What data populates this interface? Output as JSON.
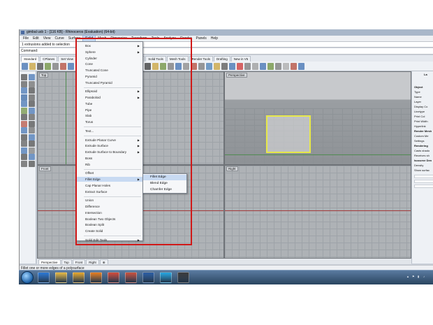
{
  "window": {
    "title": "gimbal usb 1 - [116 KB] - Rhinoceros (Evaluation) (64-bit)"
  },
  "menubar": {
    "items": [
      "File",
      "Edit",
      "View",
      "Curve",
      "Surface",
      "Solid",
      "Mesh",
      "Dimension",
      "Transform",
      "Tools",
      "Analyze",
      "Render",
      "Panels",
      "Help"
    ],
    "active": "Solid"
  },
  "command_history": "1 extrusions added to selection",
  "command": {
    "label": "Command:",
    "value": ""
  },
  "toolbar_tabs": [
    {
      "label": "Standard",
      "selected": true
    },
    {
      "label": "CPlanes"
    },
    {
      "label": "Set View"
    },
    {
      "label": "Transform"
    },
    {
      "label": "Curve Tools"
    },
    {
      "label": "Surface Tools"
    },
    {
      "label": "Solid Tools"
    },
    {
      "label": "Mesh Tools"
    },
    {
      "label": "Render Tools"
    },
    {
      "label": "Drafting"
    },
    {
      "label": "New in V5"
    }
  ],
  "viewports": {
    "top": "Top",
    "perspective": "Perspective",
    "front": "Front",
    "right": "Right"
  },
  "viewport_tabs": [
    {
      "label": "Perspective",
      "selected": true
    },
    {
      "label": "Top"
    },
    {
      "label": "Front"
    },
    {
      "label": "Right"
    },
    {
      "label": "⊕"
    }
  ],
  "solid_menu": [
    {
      "label": "Box",
      "submenu": true
    },
    {
      "label": "Sphere",
      "submenu": true
    },
    {
      "label": "Cylinder"
    },
    {
      "label": "Cone"
    },
    {
      "label": "Truncated Cone"
    },
    {
      "label": "Pyramid"
    },
    {
      "label": "Truncated Pyramid"
    },
    {
      "sep": true
    },
    {
      "label": "Ellipsoid",
      "submenu": true
    },
    {
      "label": "Paraboloid",
      "submenu": true
    },
    {
      "label": "Tube"
    },
    {
      "label": "Pipe"
    },
    {
      "label": "Slab"
    },
    {
      "label": "Torus"
    },
    {
      "sep": true
    },
    {
      "label": "Text..."
    },
    {
      "sep": true
    },
    {
      "label": "Extrude Planar Curve",
      "submenu": true
    },
    {
      "label": "Extrude Surface",
      "submenu": true
    },
    {
      "label": "Extrude Surface to Boundary",
      "submenu": true
    },
    {
      "label": "Boss"
    },
    {
      "label": "Rib"
    },
    {
      "sep": true
    },
    {
      "label": "Offset"
    },
    {
      "label": "Fillet Edge",
      "submenu": true,
      "hover": true
    },
    {
      "label": "Cap Planar Holes"
    },
    {
      "label": "Extract Surface"
    },
    {
      "sep": true
    },
    {
      "label": "Union"
    },
    {
      "label": "Difference"
    },
    {
      "label": "Intersection"
    },
    {
      "label": "Boolean Two Objects"
    },
    {
      "label": "Boolean Split"
    },
    {
      "label": "Create Solid"
    },
    {
      "sep": true
    },
    {
      "label": "Solid Edit Tools",
      "submenu": true
    }
  ],
  "fillet_submenu": [
    "Fillet Edge",
    "Blend Edge",
    "Chamfer Edge"
  ],
  "properties_panel": {
    "tab": "La",
    "section_object": "Object",
    "fields": [
      "Type",
      "Name",
      "Layer",
      "Display Co",
      "Linetype",
      "Print Col",
      "Print Width",
      "Hyperlink"
    ],
    "section_render": "Render Mesh",
    "render_fields": [
      "Custom Me",
      "Settings"
    ],
    "section_rendering": "Rendering",
    "rendering_fields": [
      "Casts shado",
      "Receives sh"
    ],
    "section_isocurve": "Isocurve Den",
    "isocurve_fields": [
      "Density",
      "Show surfac"
    ]
  },
  "status_bar": "Fillet one or more edges of a polysurface",
  "colors": {
    "highlight_box": "#d01818",
    "selected_object": "#e7e84a",
    "menu_hover": "#c8daf2"
  },
  "taskbar": {
    "icons": [
      "start-orb",
      "ie-icon",
      "explorer-icon",
      "media-player-icon",
      "firefox-icon",
      "chrome-icon",
      "app-icon",
      "lync-icon",
      "skype-icon",
      "rhino-icon"
    ]
  }
}
